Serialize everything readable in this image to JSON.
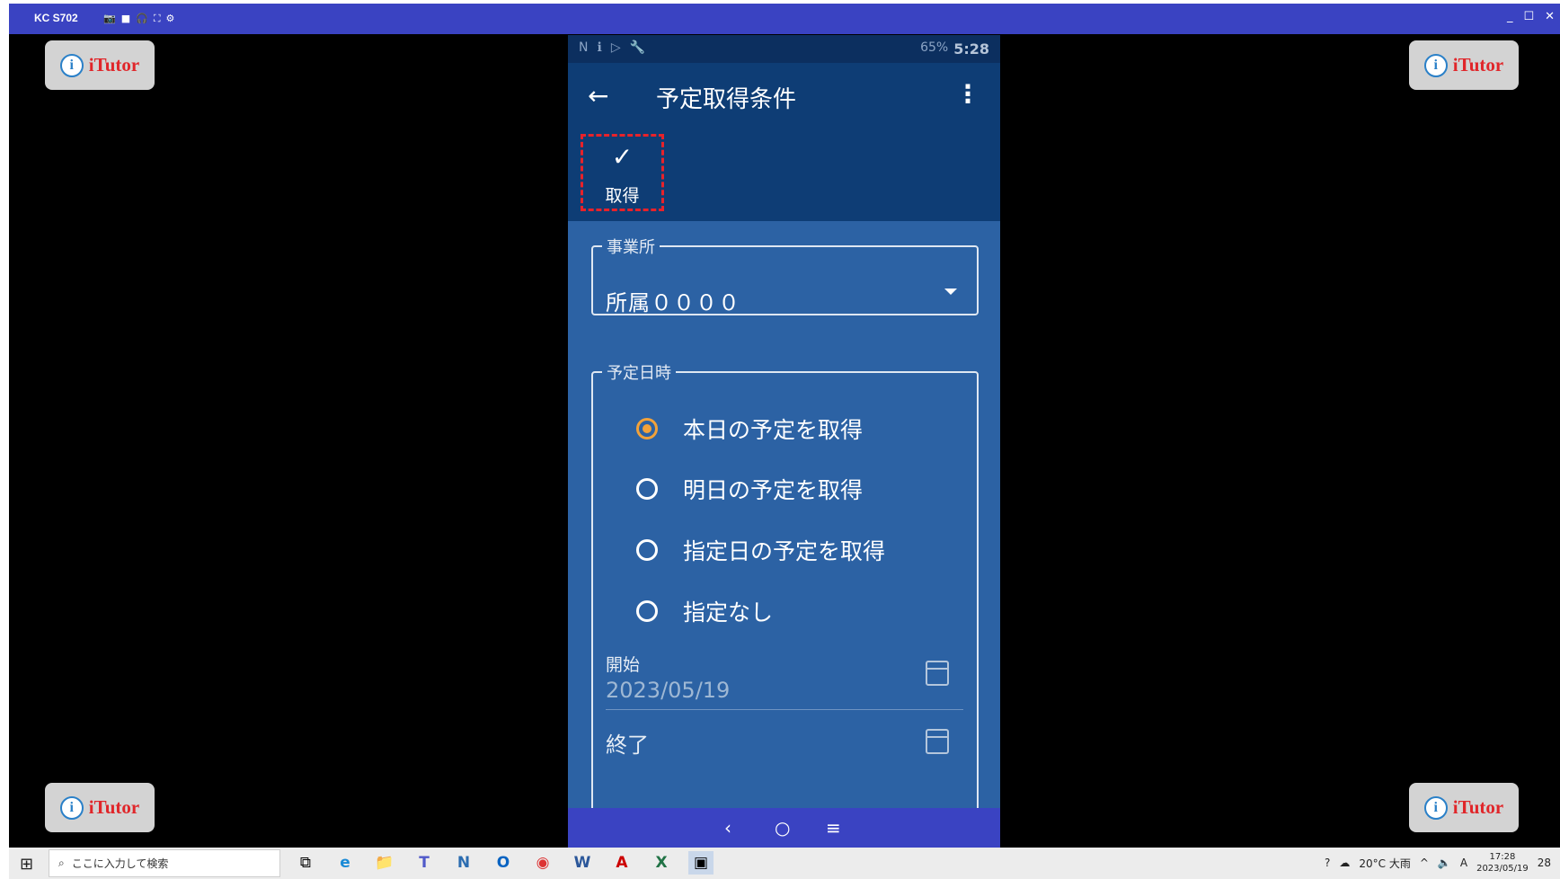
{
  "window": {
    "title": "KC S702",
    "toolbar_icons": [
      "📷",
      "■",
      "🎧",
      "⛶",
      "⚙"
    ],
    "controls": [
      "_",
      "☐",
      "✕"
    ]
  },
  "watermark": {
    "logo_letter": "i",
    "text": "iTutor"
  },
  "phone": {
    "statusbar": {
      "left_icons": [
        "N",
        "ℹ",
        "▷",
        "🔧"
      ],
      "battery": "65%",
      "time": "5:28"
    },
    "appbar": {
      "back_icon": "←",
      "title": "予定取得条件",
      "more_icon": "⋮"
    },
    "action": {
      "check_icon": "✓",
      "label": "取得"
    },
    "office_field": {
      "legend": "事業所",
      "value": "所属００００"
    },
    "date_field": {
      "legend": "予定日時",
      "options": [
        {
          "label": "本日の予定を取得",
          "selected": true
        },
        {
          "label": "明日の予定を取得",
          "selected": false
        },
        {
          "label": "指定日の予定を取得",
          "selected": false
        },
        {
          "label": "指定なし",
          "selected": false
        }
      ],
      "start": {
        "label": "開始",
        "value": "2023/05/19"
      },
      "end": {
        "label": "終了",
        "value": ""
      }
    },
    "navbar": {
      "back": "‹",
      "home": "○",
      "menu": "≡"
    }
  },
  "taskbar": {
    "start_icon": "⊞",
    "search_placeholder": "ここに入力して検索",
    "apps": [
      "⧉",
      "e",
      "📁",
      "T",
      "N",
      "O",
      "◉",
      "W",
      "A",
      "X",
      "▣"
    ],
    "weather": "20°C 大雨",
    "ime": "A",
    "time": "17:28",
    "date": "2023/05/19",
    "notifications": "28"
  }
}
